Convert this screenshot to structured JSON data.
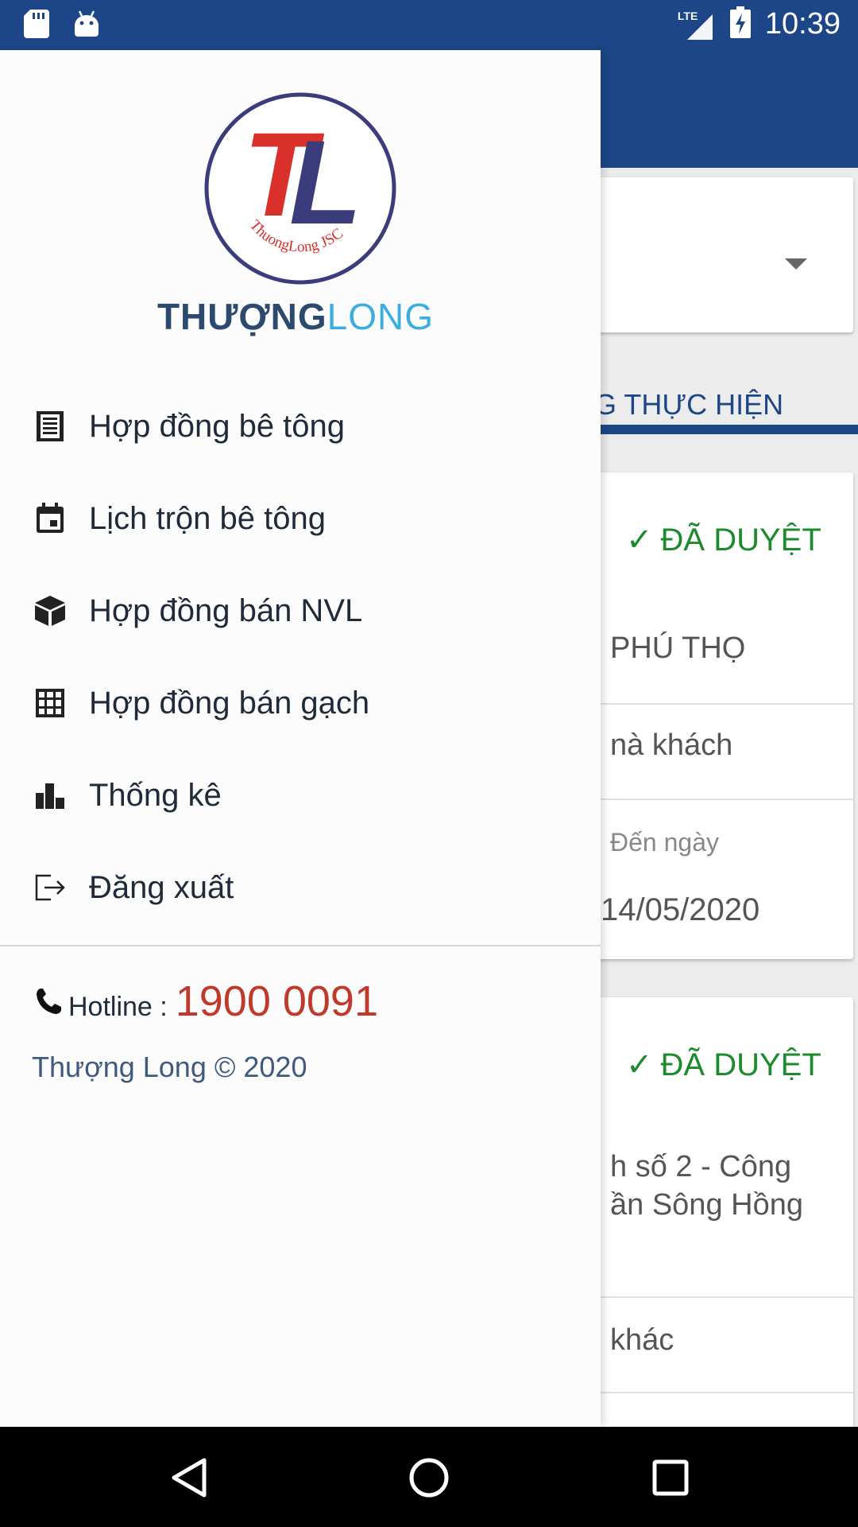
{
  "status_bar": {
    "time": "10:39",
    "network": "LTE",
    "icons": [
      "sd-card-icon",
      "android-icon",
      "signal-icon",
      "battery-charging-icon"
    ]
  },
  "background": {
    "tab_label": "G THỰC HIỆN",
    "cards": [
      {
        "status": "ĐÃ DUYỆT",
        "lines": [
          "PHÚ THỌ",
          "nà khách",
          "Đến ngày",
          "14/05/2020"
        ]
      },
      {
        "status": "ĐÃ DUYỆT",
        "lines": [
          "h số 2 - Công",
          "ần Sông Hồng",
          "khác"
        ]
      }
    ]
  },
  "drawer": {
    "logo_letters": "TL",
    "logo_ring_text": "ThuongLong JSC",
    "brand_part1": "THƯỢNG",
    "brand_part2": "LONG",
    "menu": [
      {
        "label": "Hợp đồng bê tông",
        "icon": "document-icon"
      },
      {
        "label": "Lịch trộn bê tông",
        "icon": "calendar-icon"
      },
      {
        "label": "Hợp đồng bán NVL",
        "icon": "cube-icon"
      },
      {
        "label": "Hợp đồng bán gạch",
        "icon": "grid-icon"
      },
      {
        "label": "Thống kê",
        "icon": "bar-chart-icon"
      },
      {
        "label": "Đăng xuất",
        "icon": "logout-icon"
      }
    ],
    "hotline_label": "Hotline :",
    "hotline_number": "1900 0091",
    "copyright": "Thượng Long © 2020"
  },
  "colors": {
    "primary": "#1d4688",
    "approved": "#1e8a2e",
    "hotline": "#c0392b",
    "brand_dark": "#2c4a6e",
    "brand_light": "#3aaee0"
  }
}
